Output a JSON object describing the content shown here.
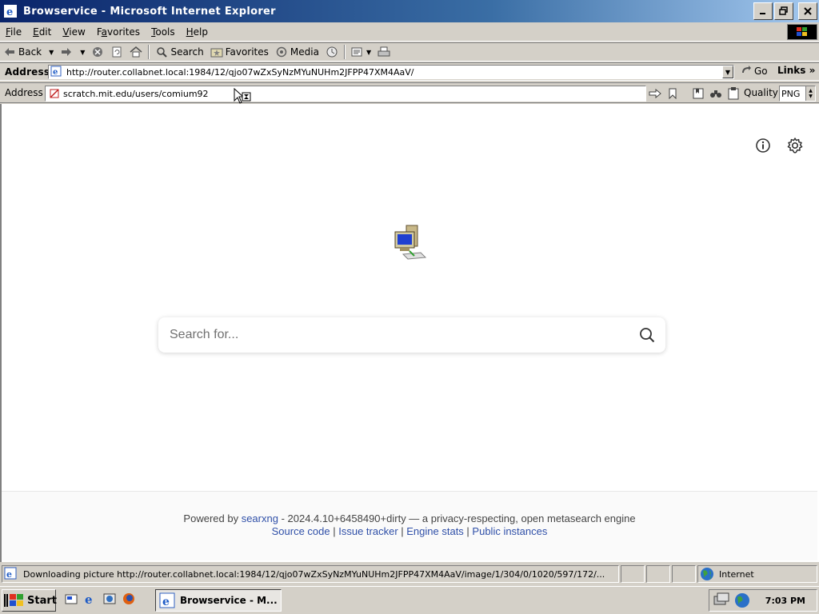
{
  "window": {
    "title": "Browservice - Microsoft Internet Explorer"
  },
  "menu": {
    "items": [
      {
        "label": "File",
        "accel": "F",
        "rest": "ile"
      },
      {
        "label": "Edit",
        "accel": "E",
        "rest": "dit"
      },
      {
        "label": "View",
        "accel": "V",
        "rest": "iew"
      },
      {
        "label": "Favorites",
        "accel": "a",
        "pre": "F",
        "rest": "vorites"
      },
      {
        "label": "Tools",
        "accel": "T",
        "rest": "ools"
      },
      {
        "label": "Help",
        "accel": "H",
        "rest": "elp"
      }
    ]
  },
  "toolbar": {
    "back": "Back",
    "search": "Search",
    "favorites": "Favorites",
    "media": "Media"
  },
  "address": {
    "label": "Address",
    "url": "http://router.collabnet.local:1984/12/qjo07wZxSyNzMYuNUHm2JFPP47XM4AaV/",
    "go": "Go",
    "links": "Links"
  },
  "viewer": {
    "label": "Address",
    "url": "scratch.mit.edu/users/comium92",
    "quality_label": "Quality",
    "quality_value": "PNG"
  },
  "page": {
    "search_placeholder": "Search for...",
    "footer": {
      "powered_by": "Powered by",
      "engine_link": "searxng",
      "version_text": " - 2024.4.10+6458490+dirty — a privacy-respecting, open metasearch engine",
      "links": [
        "Source code",
        "Issue tracker",
        "Engine stats",
        "Public instances"
      ],
      "separator": " | "
    }
  },
  "status": {
    "text": "Downloading picture http://router.collabnet.local:1984/12/qjo07wZxSyNzMYuNUHm2JFPP47XM4AaV/image/1/304/0/1020/597/172/...",
    "zone": "Internet"
  },
  "taskbar": {
    "start": "Start",
    "task": "Browservice - M...",
    "clock": "7:03 PM"
  }
}
